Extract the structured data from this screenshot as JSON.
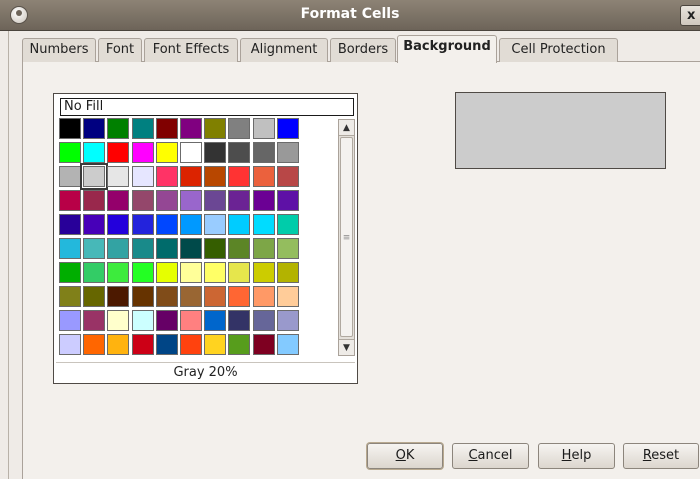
{
  "window": {
    "title": "Format Cells",
    "close_label": "x"
  },
  "tabs": [
    {
      "label": "Numbers"
    },
    {
      "label": "Font"
    },
    {
      "label": "Font Effects"
    },
    {
      "label": "Alignment"
    },
    {
      "label": "Borders"
    },
    {
      "label": "Background",
      "active": true
    },
    {
      "label": "Cell Protection"
    }
  ],
  "background": {
    "no_fill_label": "No Fill",
    "selected_color_name": "Gray 20%",
    "preview_color": "#cccccc",
    "selected_index": [
      2,
      1
    ],
    "palette": [
      [
        "#000000",
        "#000080",
        "#008000",
        "#008080",
        "#800000",
        "#800080",
        "#808000",
        "#808080",
        "#c0c0c0",
        "#0000ff"
      ],
      [
        "#00ff00",
        "#00ffff",
        "#ff0000",
        "#ff00ff",
        "#ffff00",
        "#ffffff",
        "#333333",
        "#4d4d4d",
        "#666666",
        "#999999"
      ],
      [
        "#b3b3b3",
        "#cccccc",
        "#e6e6e6",
        "#e6e6ff",
        "#ff3366",
        "#dc2300",
        "#b84700",
        "#ff3333",
        "#eb613d",
        "#b84747"
      ],
      [
        "#b80047",
        "#99284c",
        "#94006b",
        "#94476b",
        "#944794",
        "#9966cc",
        "#6b4794",
        "#6b2394",
        "#6b0094",
        "#5e11a6"
      ],
      [
        "#280099",
        "#4700b8",
        "#2300dc",
        "#2323dc",
        "#0047ff",
        "#0099ff",
        "#99ccff",
        "#00ccff",
        "#00dcff",
        "#00ccaa"
      ],
      [
        "#23b8dc",
        "#47b8b8",
        "#33a3a3",
        "#198a8a",
        "#006b6b",
        "#004a4a",
        "#355e00",
        "#5c8526",
        "#7da647",
        "#94bd5e"
      ],
      [
        "#00ae00",
        "#33cc66",
        "#3deb3d",
        "#23ff23",
        "#e6ff00",
        "#ffff99",
        "#ffff66",
        "#e6e64c",
        "#cccc00",
        "#b3b300"
      ],
      [
        "#808019",
        "#666600",
        "#4c1900",
        "#663300",
        "#804c19",
        "#996633",
        "#cc6633",
        "#ff6633",
        "#ff9966",
        "#ffcc99"
      ],
      [
        "#9999ff",
        "#993366",
        "#ffffcc",
        "#ccffff",
        "#660066",
        "#ff8080",
        "#0066cc",
        "#333366",
        "#666699",
        "#9999cc"
      ],
      [
        "#ccccff",
        "#ff6600",
        "#ffb30f",
        "#cc0016",
        "#004586",
        "#ff420e",
        "#ffd320",
        "#579d1c",
        "#7e0021",
        "#83caff"
      ]
    ]
  },
  "buttons": {
    "ok": {
      "mnemonic": "O",
      "rest": "K"
    },
    "cancel": {
      "mnemonic": "C",
      "rest": "ancel"
    },
    "help": {
      "mnemonic": "H",
      "rest": "elp"
    },
    "reset": {
      "mnemonic": "R",
      "rest": "eset"
    }
  }
}
